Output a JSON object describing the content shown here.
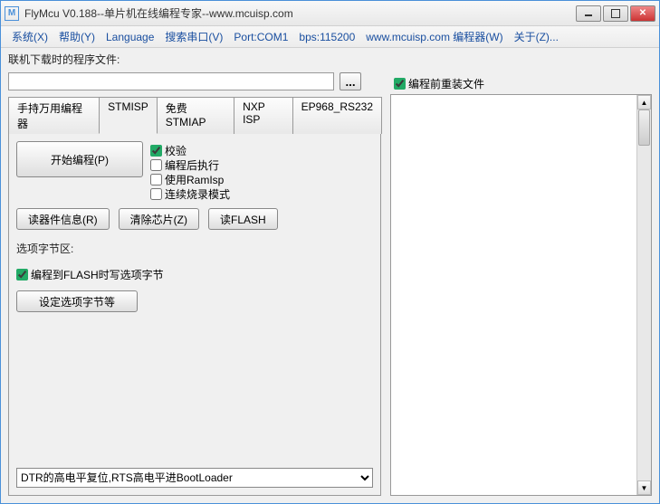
{
  "title": "FlyMcu V0.188--单片机在线编程专家--www.mcuisp.com",
  "menu": {
    "system": "系统(X)",
    "help": "帮助(Y)",
    "language": "Language",
    "search_port": "搜索串口(V)",
    "port": "Port:COM1",
    "bps": "bps:115200",
    "site": "www.mcuisp.com 编程器(W)",
    "about": "关于(Z)..."
  },
  "labels": {
    "file_label": "联机下载时的程序文件:",
    "reload_checkbox": "编程前重装文件",
    "option_section": "选项字节区:",
    "flash_option": "编程到FLASH时写选项字节"
  },
  "buttons": {
    "browse": "...",
    "start_prog": "开始编程(P)",
    "read_info": "读器件信息(R)",
    "erase_chip": "清除芯片(Z)",
    "read_flash": "读FLASH",
    "set_option": "设定选项字节等"
  },
  "tabs": [
    "手持万用编程器",
    "STMISP",
    "免费STMIAP",
    "NXP ISP",
    "EP968_RS232"
  ],
  "active_tab": 1,
  "checks": {
    "verify": "校验",
    "run_after": "编程后执行",
    "use_ramisp": "使用RamIsp",
    "continuous": "连续烧录模式"
  },
  "checks_state": {
    "verify": true,
    "run_after": false,
    "use_ramisp": false,
    "continuous": false
  },
  "flash_option_checked": true,
  "reload_checked": true,
  "dropdown_value": "DTR的高电平复位,RTS高电平进BootLoader",
  "file_path": ""
}
